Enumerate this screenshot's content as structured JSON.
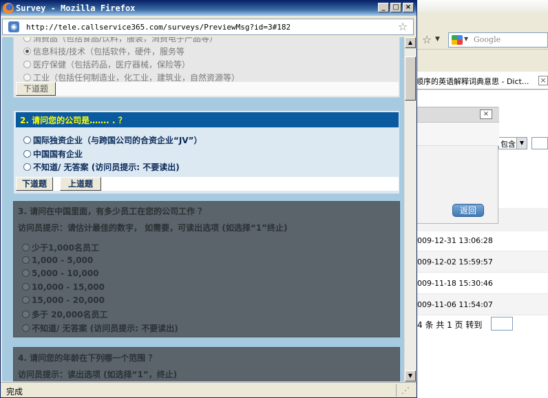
{
  "background_window": {
    "search_placeholder": "Google",
    "tab_title": "顺序的英语解释词典意思 - Dict...",
    "dialog_close": "×",
    "dialog_return_button": "返回",
    "select_value": "包含",
    "rows": [
      "009-12-31 13:06:28",
      "009-12-02 15:59:57",
      "009-11-18 15:30:46",
      "009-11-06 11:54:07"
    ],
    "pager_text": "4 条 共 1 页 转到"
  },
  "window": {
    "title": "Survey - Mozilla Firefox",
    "minimize": "_",
    "maximize": "□",
    "close": "×",
    "url": "http://tele.callservice365.com/surveys/PreviewMsg?id=3#182"
  },
  "status": {
    "text": "完成"
  },
  "survey": {
    "q1": {
      "options": [
        {
          "label": "消费品（包括食品/饮料，服装，消费电子产品等）",
          "selected": false
        },
        {
          "label": "信息科技/技术（包括软件，硬件，服务等",
          "selected": true
        },
        {
          "label": "医疗保健（包括药品，医疗器械，保险等）",
          "selected": false
        },
        {
          "label": "工业（包括任何制造业，化工业，建筑业，自然资源等）",
          "selected": false
        }
      ],
      "next_button": "下道题"
    },
    "q2": {
      "title": "2. 请问您的公司是……. . ？",
      "options": [
        "国际独资企业（与跨国公司的合资企业“JV”）",
        "中国国有企业",
        "不知道/ 无答案 (访问员提示: 不要读出)"
      ],
      "next_button": "下道题",
      "prev_button": "上道题"
    },
    "q3": {
      "title": "3. 请问在中国里面，有多少员工在您的公司工作 ？",
      "hint": "访问员提示：请估计最佳的数字， 如需要，可读出选项 (如选择“1”终止)",
      "options": [
        "少于1,000名员工",
        "1,000 - 5,000",
        "5,000 - 10,000",
        "10,000 - 15,000",
        "15,000 - 20,000",
        "多于 20,000名员工",
        "不知道/ 无答案 (访问员提示: 不要读出)"
      ]
    },
    "q4": {
      "title": "4. 请问您的年龄在下列哪一个范围 ？",
      "hint": "访问员提示：读出选项 (如选择“1”，终止)"
    }
  }
}
